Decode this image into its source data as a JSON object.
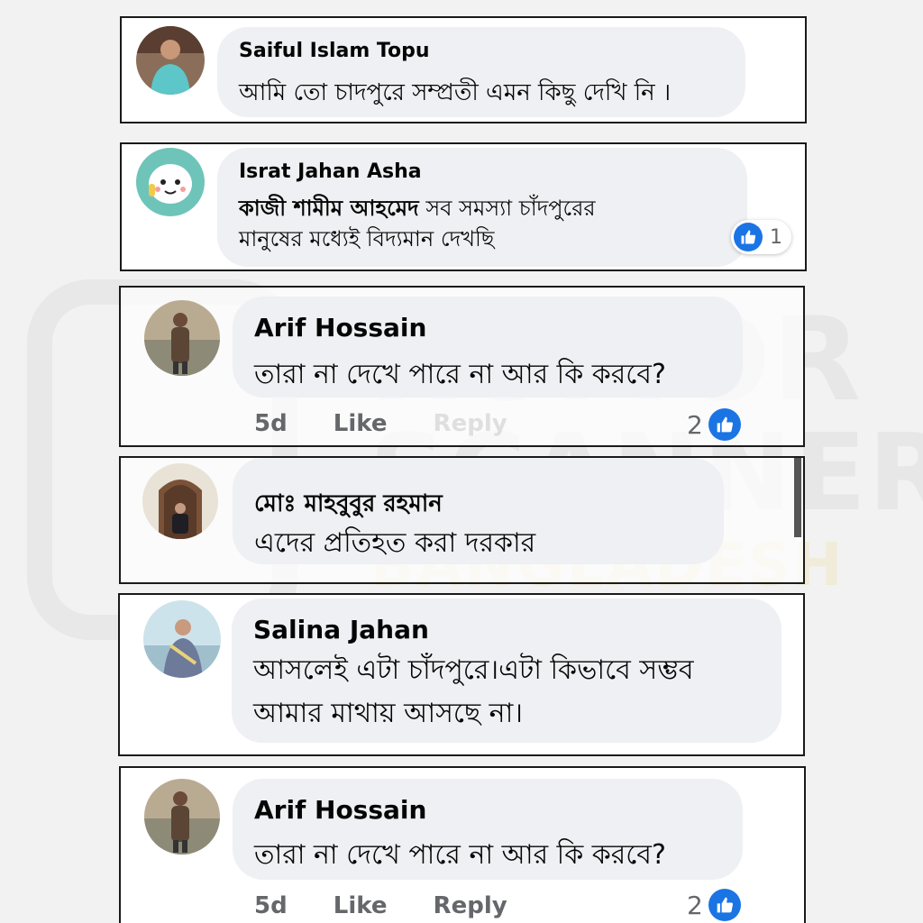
{
  "watermark": {
    "line1": "RUMOR",
    "line2": "SCANNER",
    "line3": "BANGLADESH"
  },
  "comments": [
    {
      "name": "Saiful Islam Topu",
      "text": "আমি তো চাদপুরে সম্প্রতী এমন কিছু দেখি নি ।"
    },
    {
      "name": "Israt Jahan Asha",
      "tag": "কাজী শামীম আহমেদ",
      "text_line1": "সব সমস্যা চাঁদপুরের",
      "text_line2": "মানুষের মধ্যেই বিদ্যমান দেখছি",
      "like_count": "1"
    },
    {
      "name": "Arif Hossain",
      "text": "তারা না দেখে পারে না আর কি করবে?",
      "time": "5d",
      "like_label": "Like",
      "reply_label": "Reply",
      "like_count": "2"
    },
    {
      "name": "মোঃ মাহবুবুর রহমান",
      "text": "এদের প্রতিহত করা দরকার"
    },
    {
      "name": "Salina Jahan",
      "text_line1": "আসলেই এটা চাঁদপুরে।এটা কিভাবে সম্ভব",
      "text_line2": "আমার মাথায় আসছে না।"
    },
    {
      "name": "Arif Hossain",
      "text": "তারা না দেখে পারে না আর কি করবে?",
      "time": "5d",
      "like_label": "Like",
      "reply_label": "Reply",
      "like_count": "2"
    }
  ],
  "colors": {
    "bubble": "#eff0f3",
    "like_blue": "#1b74e4",
    "muted": "#65676b"
  },
  "icons": {
    "reaction": "thumbs-up-icon"
  }
}
